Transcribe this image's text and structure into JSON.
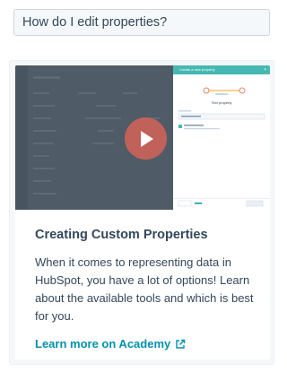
{
  "question": {
    "text": "How do I edit properties?"
  },
  "card": {
    "title": "Creating Custom Properties",
    "description": "When it comes to representing data in HubSpot, you have a lot of options! Learn about the available tools and which is best for you.",
    "link_label": "Learn more on Academy",
    "video": {
      "panel_title": "Create a new property",
      "panel_close": "×",
      "panel_heading": "Text property",
      "play_icon": "play-icon"
    }
  },
  "colors": {
    "link": "#0091ae",
    "text": "#33475b",
    "play_button": "#c0625a",
    "panel_header": "#45b8b2"
  }
}
